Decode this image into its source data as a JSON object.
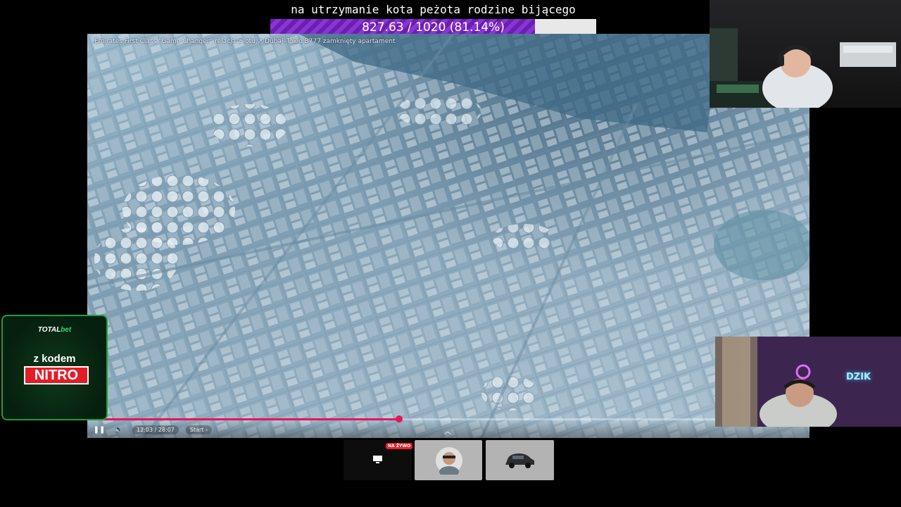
{
  "goal": {
    "title": "na utrzymanie kota peżota rodzine bijącego",
    "progress_text": "827.63 / 1020 (81.14%)",
    "current": 827.63,
    "target": 1020,
    "percent": 81.14,
    "fill_color": "#7b2bc4"
  },
  "video": {
    "title": "Emirates First Class “Game Changer” relacja z lotu ↗ Dubaj–Tokio B777 zamknięty apartament",
    "time_display": "12:03 / 28:07",
    "start_label": "Start",
    "progress_fraction": 0.43,
    "accent_color": "#e8145a"
  },
  "sponsor": {
    "brand_total": "TOTAL",
    "brand_bet": "bet",
    "line1": "z kodem",
    "code": "NITRO",
    "border_color": "#1d9e3b",
    "code_color": "#e31c27"
  },
  "webcam2": {
    "sign_text": "DZIK"
  },
  "switcher": {
    "live_badge": "NA ŻYWO",
    "items": [
      "screen-share-icon",
      "webcam-thumbnail",
      "car-thumbnail"
    ]
  }
}
